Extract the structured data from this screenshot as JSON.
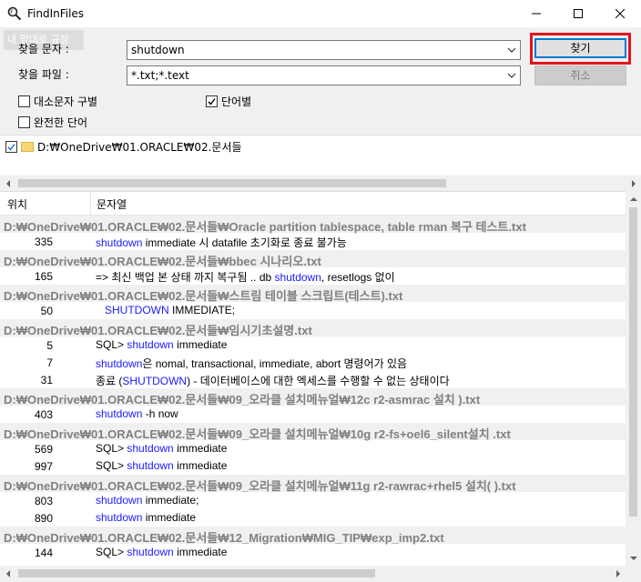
{
  "window": {
    "title": "FindInFiles",
    "watermark": "내 맘대로 규정"
  },
  "form": {
    "find_text_label": "찾을 문자 :",
    "find_text_value": "shutdown",
    "find_files_label": "찾을 파일 :",
    "find_files_value": "*.txt;*.text",
    "find_button": "찾기",
    "cancel_button": "취소"
  },
  "options": {
    "case_sensitive": {
      "label": "대소문자 구별",
      "checked": false
    },
    "whole_word_only": {
      "label": "단어별",
      "checked": true
    },
    "exact_word": {
      "label": "완전한 단어",
      "checked": false
    }
  },
  "tree": {
    "path": "D:₩OneDrive₩01.ORACLE₩02.문서들",
    "checked": true
  },
  "results": {
    "col_position": "위치",
    "col_string": "문자열",
    "rows": [
      {
        "type": "file",
        "text": "D:₩OneDrive₩01.ORACLE₩02.문서들₩Oracle partition tablespace, table rman 복구 테스트.txt"
      },
      {
        "type": "hit",
        "line": "335",
        "kw": "shutdown",
        "rest": " immediate 시 datafile 초기화로 종료 불가능",
        "pre": ""
      },
      {
        "type": "file",
        "text": "D:₩OneDrive₩01.ORACLE₩02.문서들₩bbec              시나리오.txt"
      },
      {
        "type": "hit",
        "line": "165",
        "pre": "=> 최신 백업 본 상태 까지 복구됨 .. db ",
        "kw": "shutdown",
        "rest": ", resetlogs 없이"
      },
      {
        "type": "file",
        "text": "D:₩OneDrive₩01.ORACLE₩02.문서들₩스트림 테이블 스크립트(테스트).txt"
      },
      {
        "type": "hit",
        "line": "50",
        "pre": "   ",
        "kw": "SHUTDOWN",
        "rest": " IMMEDIATE;"
      },
      {
        "type": "file",
        "text": "D:₩OneDrive₩01.ORACLE₩02.문서들₩임시기초설명.txt"
      },
      {
        "type": "hit",
        "line": "5",
        "pre": "SQL> ",
        "kw": "shutdown",
        "rest": " immediate"
      },
      {
        "type": "hit",
        "line": "7",
        "pre": "",
        "kw": "shutdown",
        "rest": "은 nomal, transactional, immediate, abort 명령어가 있음"
      },
      {
        "type": "hit",
        "line": "31",
        "pre": "종료 (",
        "kw": "SHUTDOWN",
        "rest": ") - 데이터베이스에 대한 엑세스를 수행할 수 없는 상태이다"
      },
      {
        "type": "file",
        "text": "D:₩OneDrive₩01.ORACLE₩02.문서들₩09_오라클 설치메뉴얼₩12c r2-asmrac 설치           ).txt"
      },
      {
        "type": "hit",
        "line": "403",
        "pre": "",
        "kw": "shutdown",
        "rest": " -h now"
      },
      {
        "type": "file",
        "text": "D:₩OneDrive₩01.ORACLE₩02.문서들₩09_오라클 설치메뉴얼₩10g r2-fs+oel6_silent설치           .txt"
      },
      {
        "type": "hit",
        "line": "569",
        "pre": "SQL> ",
        "kw": "shutdown",
        "rest": " immediate"
      },
      {
        "type": "hit",
        "line": "997",
        "pre": "SQL> ",
        "kw": "shutdown",
        "rest": " immediate"
      },
      {
        "type": "file",
        "text": "D:₩OneDrive₩01.ORACLE₩02.문서들₩09_오라클 설치메뉴얼₩11g r2-rawrac+rhel5 설치(          ).txt"
      },
      {
        "type": "hit",
        "line": "803",
        "pre": "",
        "kw": "shutdown",
        "rest": " immediate;"
      },
      {
        "type": "hit",
        "line": "890",
        "pre": "",
        "kw": "shutdown",
        "rest": " immediate"
      },
      {
        "type": "file",
        "text": "D:₩OneDrive₩01.ORACLE₩02.문서들₩12_Migration₩MIG_TIP₩exp_imp2.txt"
      },
      {
        "type": "hit",
        "line": "144",
        "pre": "SQL> ",
        "kw": "shutdown",
        "rest": " immediate"
      }
    ]
  },
  "colors": {
    "keyword": "#1a1aff",
    "file_row_bg": "#f0f0f0",
    "highlight_outline": "#e0141e"
  }
}
